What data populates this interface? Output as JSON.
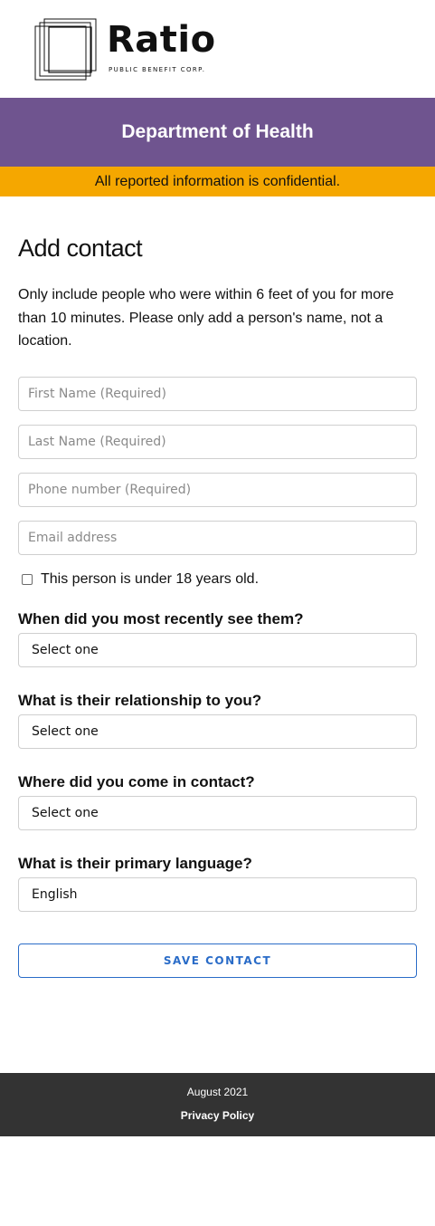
{
  "brand": {
    "name": "Ratio",
    "tagline": "PUBLIC BENEFIT CORP."
  },
  "header": {
    "department": "Department of Health",
    "notice": "All reported information is confidential."
  },
  "form": {
    "title": "Add contact",
    "intro": "Only include people who were within 6 feet of you for more than 10 minutes. Please only add a person's name, not a location.",
    "first_name_placeholder": "First Name (Required)",
    "last_name_placeholder": "Last Name (Required)",
    "phone_placeholder": "Phone number (Required)",
    "email_placeholder": "Email address",
    "under18_label": "This person is under 18 years old.",
    "questions": [
      {
        "label": "When did you most recently see them?",
        "value": "Select one"
      },
      {
        "label": "What is their relationship to you?",
        "value": "Select one"
      },
      {
        "label": "Where did you come in contact?",
        "value": "Select one"
      },
      {
        "label": "What is their primary language?",
        "value": "English"
      }
    ],
    "save_label": "SAVE CONTACT"
  },
  "footer": {
    "date": "August 2021",
    "privacy_label": "Privacy Policy"
  },
  "colors": {
    "department_bar": "#6f548f",
    "notice_bar": "#f5a700",
    "accent_blue": "#2a6cc8",
    "footer_bg": "#333333"
  },
  "icons": {
    "logo": "overlapping-squares-logo-icon"
  }
}
